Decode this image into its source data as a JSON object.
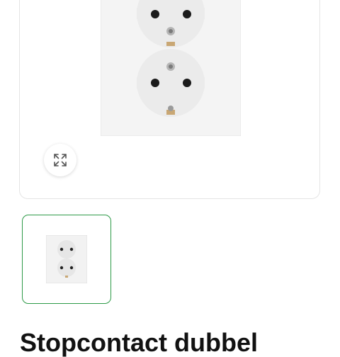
{
  "gallery": {
    "main_image_alt": "Double socket outlet",
    "expand_icon": "expand-arrows-icon",
    "thumbnails": [
      {
        "alt": "Double socket outlet thumbnail",
        "selected": true
      }
    ],
    "selected_border_color": "#2d9a47"
  },
  "product": {
    "title": "Stopcontact dubbel"
  }
}
